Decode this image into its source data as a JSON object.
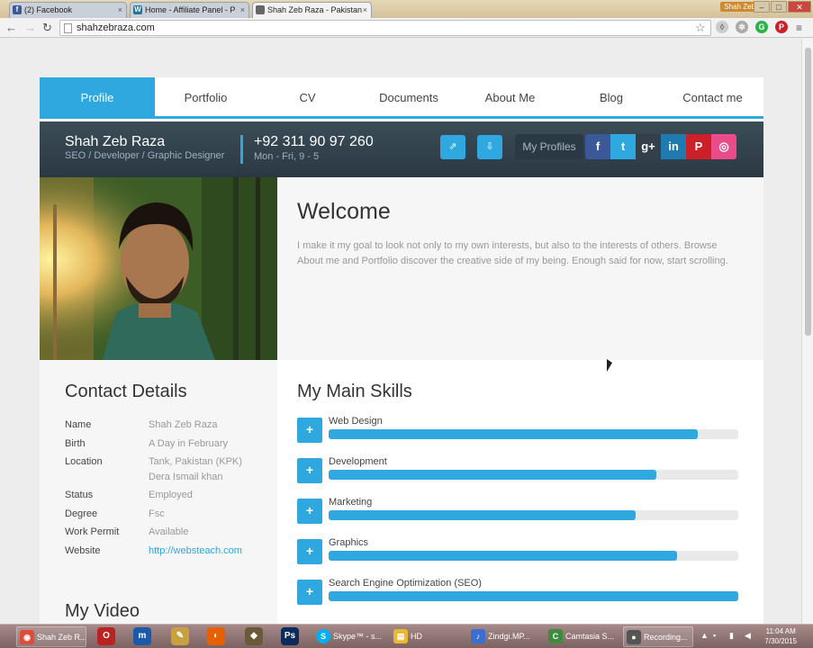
{
  "browser": {
    "tabs": [
      {
        "label": "(2) Facebook",
        "icon": "facebook-icon",
        "color": "#3b5998",
        "letter": "f"
      },
      {
        "label": "Home - Affiliate Panel - P",
        "icon": "wordpress-icon",
        "color": "#21759b",
        "letter": "W"
      },
      {
        "label": "Shah Zeb Raza - Pakistan",
        "icon": "page-icon",
        "color": "#666666",
        "letter": ""
      }
    ],
    "user_badge": "Shah Zeb",
    "url": "shahzebraza.com"
  },
  "site": {
    "nav": [
      "Profile",
      "Portfolio",
      "CV",
      "Documents",
      "About Me",
      "Blog",
      "Contact me"
    ],
    "active_nav": "Profile",
    "accent": "#2ea8df",
    "banner": {
      "name": "Shah Zeb Raza",
      "role": "SEO / Developer / Graphic Designer",
      "phone": "+92 311 90 97 260",
      "hours": "Mon - Fri, 9 - 5",
      "profiles_label": "My Profiles"
    },
    "social": [
      {
        "name": "facebook-icon",
        "glyph": "f",
        "color": "#3b5998"
      },
      {
        "name": "twitter-icon",
        "glyph": "t",
        "color": "#2ea8df"
      },
      {
        "name": "google-plus-icon",
        "glyph": "g+",
        "color": "#333f4a"
      },
      {
        "name": "linkedin-icon",
        "glyph": "in",
        "color": "#1f7ab0"
      },
      {
        "name": "pinterest-icon",
        "glyph": "P",
        "color": "#cb2027"
      },
      {
        "name": "dribbble-icon",
        "glyph": "◎",
        "color": "#ea4c89"
      }
    ],
    "welcome": {
      "title": "Welcome",
      "text": "I make it my goal to look not only to my own interests, but also to the interests of others. Browse About me and Portfolio discover the creative side of my being. Enough said for now, start scrolling."
    },
    "contact": {
      "title": "Contact Details",
      "rows": [
        {
          "k": "Name",
          "v": "Shah Zeb Raza"
        },
        {
          "k": "Birth",
          "v": "A Day in February"
        },
        {
          "k": "Location",
          "v": "Tank, Pakistan (KPK) Dera Ismail khan"
        },
        {
          "k": "Status",
          "v": "Employed"
        },
        {
          "k": "Degree",
          "v": "Fsc"
        },
        {
          "k": "Work Permit",
          "v": "Available"
        },
        {
          "k": "Website",
          "v": "http://websteach.com"
        }
      ]
    },
    "video_title": "My Video",
    "skills": {
      "title": "My Main Skills",
      "items": [
        {
          "name": "Web Design",
          "level": 0.9
        },
        {
          "name": "Development",
          "level": 0.8
        },
        {
          "name": "Marketing",
          "level": 0.75
        },
        {
          "name": "Graphics",
          "level": 0.85
        },
        {
          "name": "Search Engine Optimization (SEO)",
          "level": 1.0
        }
      ]
    }
  },
  "taskbar": {
    "items": [
      {
        "label": "Shah Zeb R...",
        "color": "#dd4b39",
        "glyph": "◉"
      },
      {
        "label": "Skype™ - s...",
        "color": "#00aff0",
        "glyph": "S"
      },
      {
        "label": "HD",
        "color": "#e8b830",
        "glyph": "▤"
      },
      {
        "label": "Zindgi.MP...",
        "color": "#3a6ed0",
        "glyph": "♪"
      },
      {
        "label": "Camtasia S...",
        "color": "#3e8b3e",
        "glyph": "C"
      },
      {
        "label": "Recording...",
        "color": "#555555",
        "glyph": "●"
      }
    ],
    "time": "11:04 AM",
    "date": "7/30/2015"
  }
}
